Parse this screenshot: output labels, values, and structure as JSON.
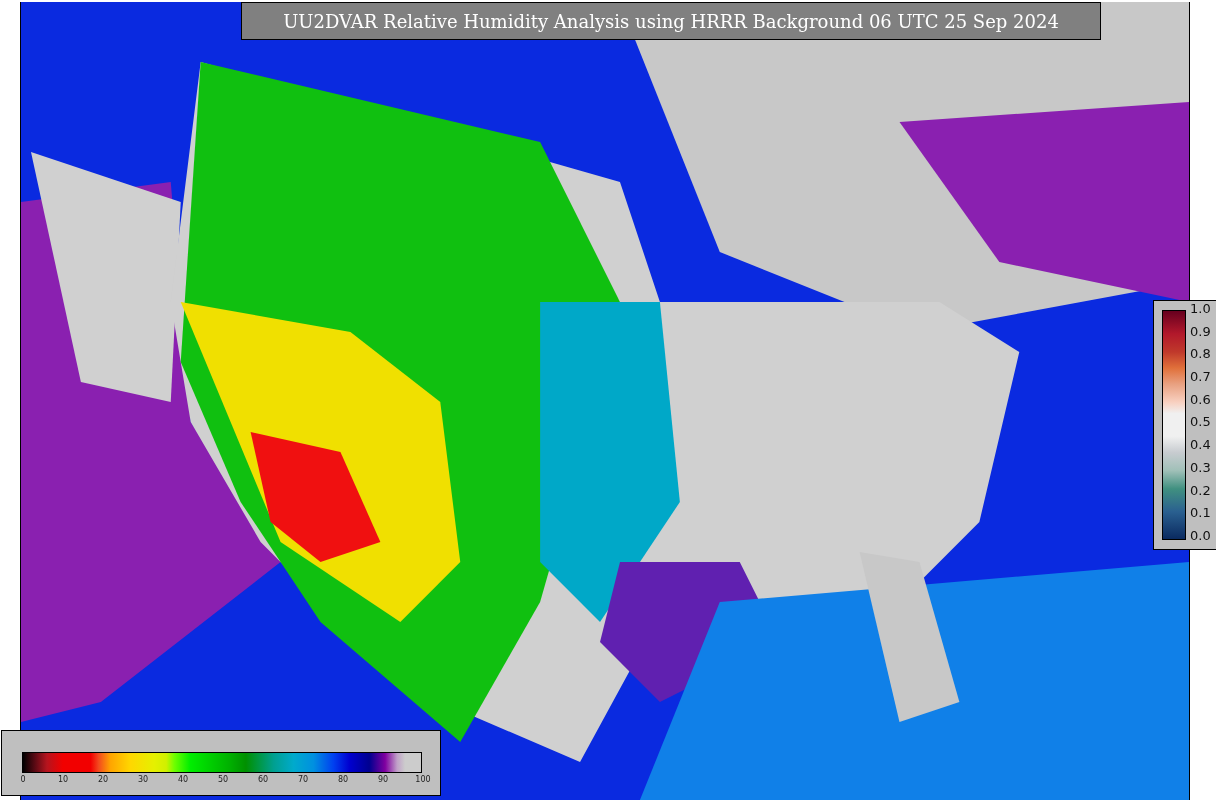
{
  "title": "UU2DVAR Relative Humidity Analysis using HRRR Background 06 UTC 25 Sep 2024",
  "humidity_legend": {
    "ticks": [
      "0",
      "10",
      "20",
      "30",
      "40",
      "50",
      "60",
      "70",
      "80",
      "90",
      "100"
    ]
  },
  "ratio_legend": {
    "ticks": [
      "1.0",
      "0.9",
      "0.8",
      "0.7",
      "0.6",
      "0.5",
      "0.4",
      "0.3",
      "0.2",
      "0.1",
      "0.0"
    ]
  }
}
